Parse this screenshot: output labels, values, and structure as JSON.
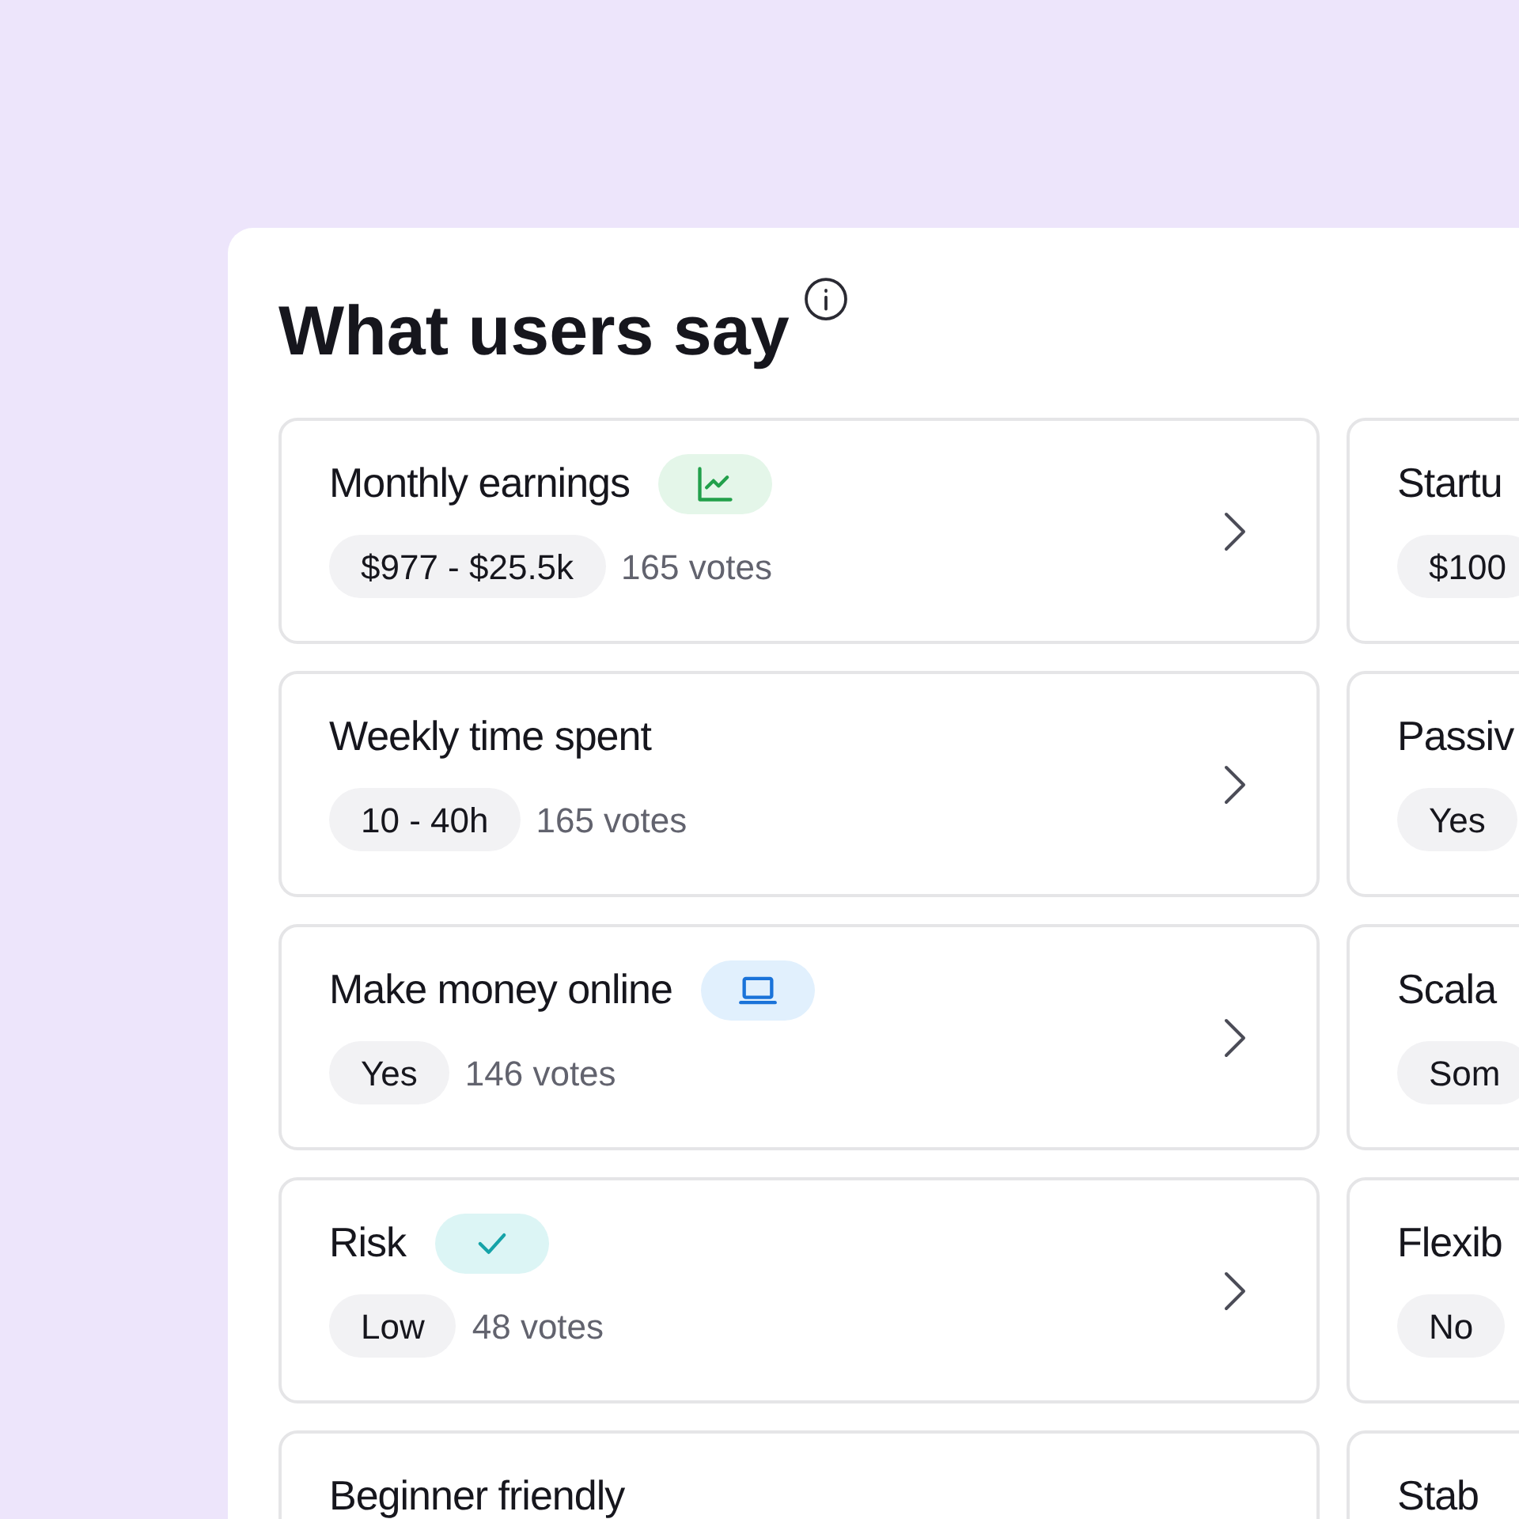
{
  "title": "What users say",
  "columns": [
    {
      "cards": [
        {
          "kind": "chart",
          "title": "Monthly earnings",
          "value": "$977 - $25.5k",
          "votes": "165 votes"
        },
        {
          "kind": "plain",
          "title": "Weekly time spent",
          "value": "10 - 40h",
          "votes": "165 votes"
        },
        {
          "kind": "laptop",
          "title": "Make money online",
          "value": "Yes",
          "votes": "146 votes"
        },
        {
          "kind": "check",
          "title": "Risk",
          "value": "Low",
          "votes": "48 votes"
        },
        {
          "kind": "plain",
          "title": "Beginner friendly"
        }
      ]
    },
    {
      "cards": [
        {
          "kind": "plain",
          "title": "Startu",
          "value": "$100"
        },
        {
          "kind": "plain",
          "title": "Passiv",
          "value": "Yes"
        },
        {
          "kind": "plain",
          "title": "Scala",
          "value": "Som"
        },
        {
          "kind": "plain",
          "title": "Flexib",
          "value": "No"
        },
        {
          "kind": "plain",
          "title": "Stab"
        }
      ]
    }
  ]
}
